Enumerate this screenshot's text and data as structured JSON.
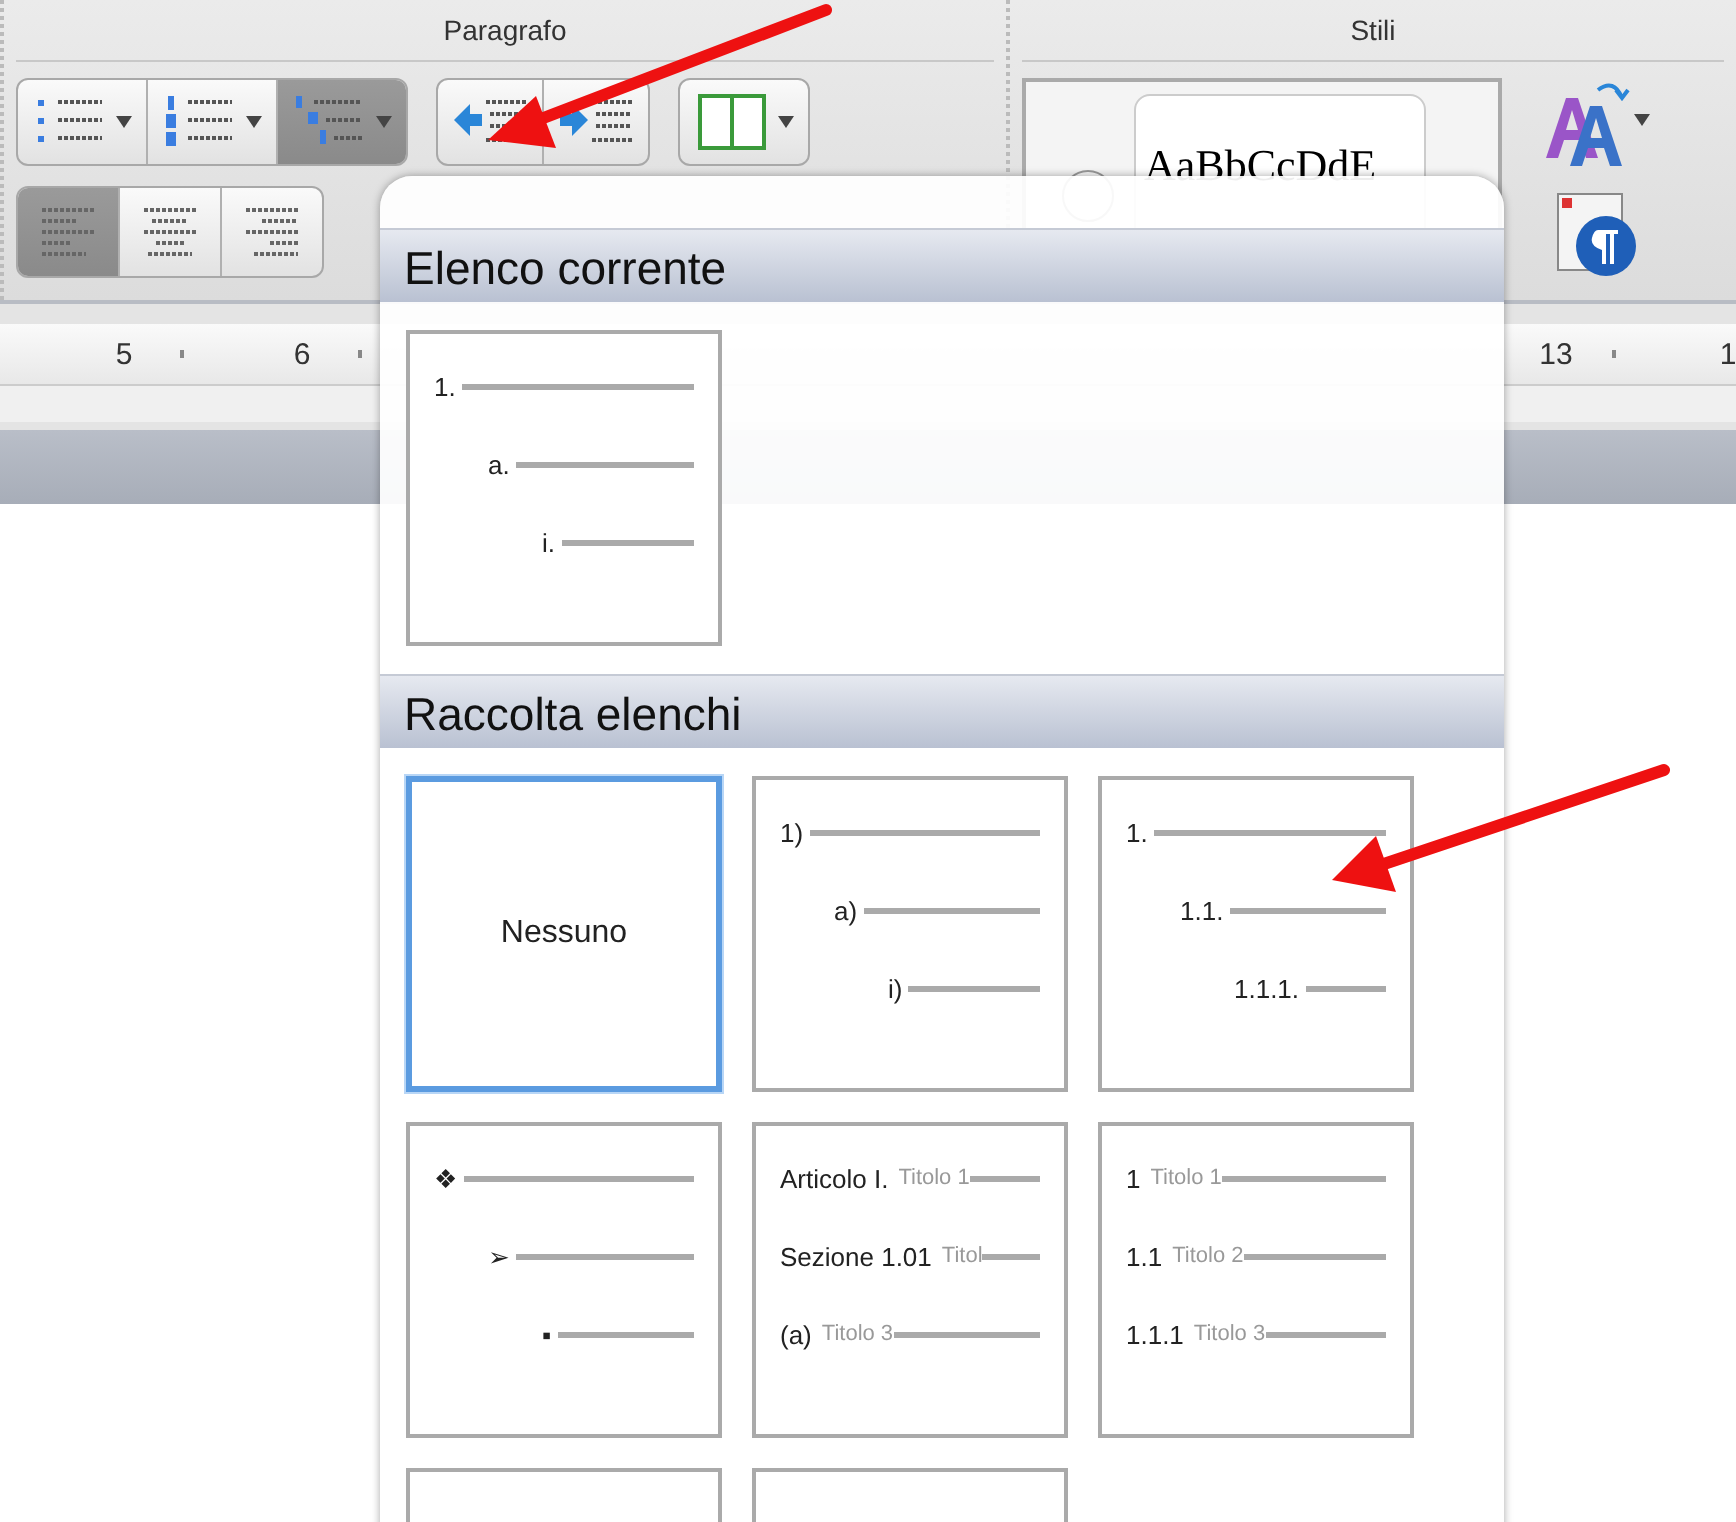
{
  "ribbon": {
    "paragraph_title": "Paragrafo",
    "styles_title": "Stili",
    "list_buttons": [
      {
        "kind": "bullets",
        "selected": false
      },
      {
        "kind": "numbering",
        "selected": false
      },
      {
        "kind": "multilevel",
        "selected": true
      }
    ],
    "align_buttons": [
      {
        "kind": "left",
        "selected": true
      },
      {
        "kind": "center",
        "selected": false
      },
      {
        "kind": "right",
        "selected": false
      }
    ],
    "style_preview": "AaBbCcDdE"
  },
  "ruler": {
    "left_labels": [
      "5",
      "6"
    ],
    "right_labels": [
      "13",
      "1"
    ]
  },
  "dropdown": {
    "current_title": "Elenco corrente",
    "current_tile": {
      "kind": "levels",
      "selected": false,
      "levels": [
        {
          "marker": "1.",
          "children": [
            {
              "marker": "a.",
              "children": [
                {
                  "marker": "i."
                }
              ]
            }
          ]
        }
      ]
    },
    "gallery_title": "Raccolta elenchi",
    "gallery_tiles": [
      {
        "kind": "none",
        "selected": true,
        "label": "Nessuno"
      },
      {
        "kind": "levels",
        "selected": false,
        "levels": [
          {
            "marker": "1)",
            "children": [
              {
                "marker": "a)",
                "children": [
                  {
                    "marker": "i)"
                  }
                ]
              }
            ]
          }
        ]
      },
      {
        "kind": "levels",
        "selected": false,
        "levels": [
          {
            "marker": "1.",
            "children": [
              {
                "marker": "1.1.",
                "children": [
                  {
                    "marker": "1.1.1."
                  }
                ]
              }
            ]
          }
        ]
      },
      {
        "kind": "levels",
        "selected": false,
        "levels": [
          {
            "marker": "❖",
            "children": [
              {
                "marker": "➢",
                "children": [
                  {
                    "marker": "▪"
                  }
                ]
              }
            ]
          }
        ]
      },
      {
        "kind": "levels",
        "selected": false,
        "levels": [
          {
            "marker": "Articolo I.",
            "caption": "Titolo 1"
          },
          {
            "marker": "Sezione 1.01",
            "caption": "Titol"
          },
          {
            "marker": "(a)",
            "caption": "Titolo 3"
          }
        ]
      },
      {
        "kind": "levels",
        "selected": false,
        "levels": [
          {
            "marker": "1",
            "caption": "Titolo 1"
          },
          {
            "marker": "1.1",
            "caption": "Titolo 2"
          },
          {
            "marker": "1.1.1",
            "caption": "Titolo 3"
          }
        ]
      },
      {
        "kind": "blank",
        "selected": false
      },
      {
        "kind": "blank",
        "selected": false
      }
    ]
  }
}
